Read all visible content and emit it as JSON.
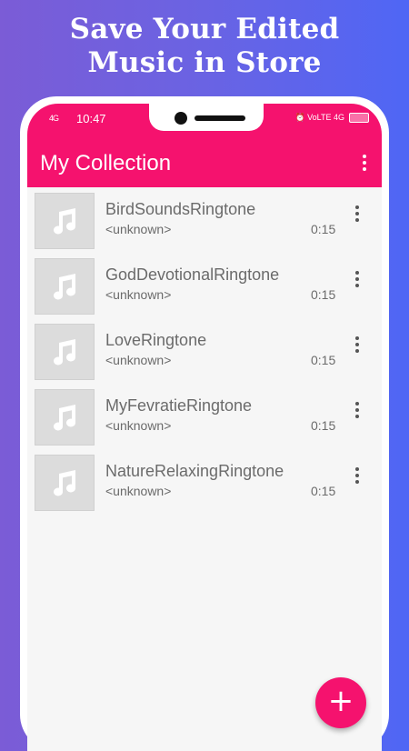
{
  "headline": {
    "line1": "Save Your Edited",
    "line2": "Music in Store"
  },
  "status_bar": {
    "signal_left": "4G ",
    "time": "10:47",
    "right_icons": "⏰ VoLTE 4G",
    "battery": ""
  },
  "app_bar": {
    "title": "My Collection",
    "menu_icon": "more-vert-icon"
  },
  "songs": [
    {
      "title": "BirdSoundsRingtone",
      "artist": "<unknown>",
      "duration": "0:15"
    },
    {
      "title": "GodDevotionalRingtone",
      "artist": "<unknown>",
      "duration": "0:15"
    },
    {
      "title": "LoveRingtone",
      "artist": "<unknown>",
      "duration": "0:15"
    },
    {
      "title": "MyFevratieRingtone",
      "artist": "<unknown>",
      "duration": "0:15"
    },
    {
      "title": "NatureRelaxingRingtone",
      "artist": "<unknown>",
      "duration": "0:15"
    }
  ],
  "fab": {
    "icon": "plus-icon",
    "label": "+"
  },
  "colors": {
    "accent": "#f5126e",
    "background_gradient_start": "#7b5cd6",
    "background_gradient_end": "#4f66f5"
  }
}
